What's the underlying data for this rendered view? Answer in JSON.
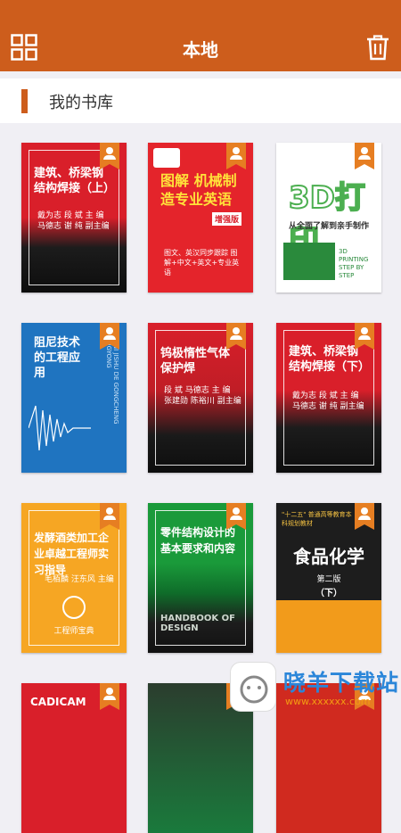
{
  "header": {
    "title": "本地",
    "grid_icon": "grid-view-icon",
    "trash_icon": "trash-icon"
  },
  "section": {
    "label": "我的书库"
  },
  "books": [
    {
      "title": "建筑、桥梁钢结构焊接（上）",
      "authors": "戴为志 段 斌 主 编",
      "coeditors": "马德志 谢 纯 副主编"
    },
    {
      "title": "图解 机械制造专业英语",
      "badge": "增强版",
      "subtitle": "图文、英汉同步跟踪 图解+中文+英文+专业英语"
    },
    {
      "title": "3D打印",
      "subtitle": "从全面了解到亲手制作",
      "tag": "3D PRINTING STEP BY STEP"
    },
    {
      "title": "阻尼技术的工程应用",
      "spine": "ZUNI JISHU DE GONGCHENG YINGYONG"
    },
    {
      "title": "钨极惰性气体保护焊",
      "authors": "段 斌 马德志 主 编",
      "coeditors": "张建勋 陈裕川 副主编"
    },
    {
      "title": "建筑、桥梁钢结构焊接（下）",
      "authors": "戴为志 段 斌 主 编",
      "coeditors": "马德志 谢 纯 副主编"
    },
    {
      "title": "发酵酒类加工企业卓越工程师实习指导",
      "authors": "毛栢麟 汪东风 主编",
      "brand": "工程师宝典"
    },
    {
      "title": "零件结构设计的基本要求和内容",
      "sub": "HANDBOOK OF DESIGN"
    },
    {
      "title": "食品化学",
      "edition": "第二版",
      "volume": "（下）",
      "series": "\"十二五\" 普通高等教育本科规划教材"
    }
  ],
  "partial_books": [
    {
      "label": "CADICAM"
    },
    {
      "label": ""
    },
    {
      "label": ""
    }
  ],
  "watermark": {
    "text": "晓羊下载站",
    "sub": "www.xxxxxx.com"
  },
  "colors": {
    "accent": "#cd5d1c",
    "background": "#f0eff4",
    "ribbon": "#e67e22"
  }
}
